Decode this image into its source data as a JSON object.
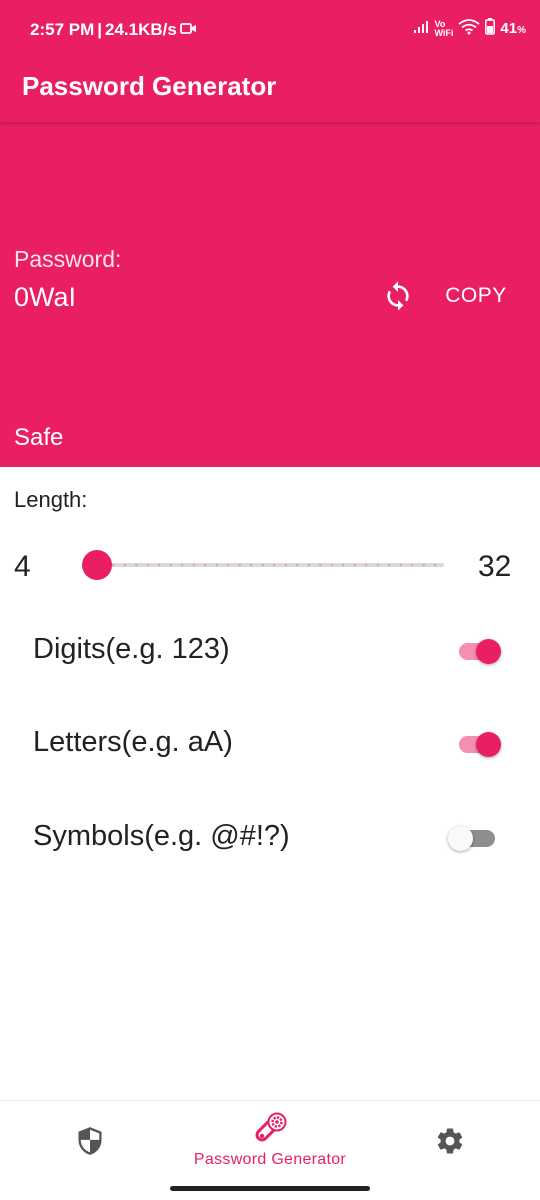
{
  "status_bar": {
    "time": "2:57 PM",
    "separator": "|",
    "speed": "24.1KB/s",
    "vowifi_top": "Vo",
    "vowifi_bottom": "WiFi",
    "battery": "41",
    "battery_unit": "%"
  },
  "app_bar": {
    "title": "Password Generator"
  },
  "password": {
    "label": "Password:",
    "value": "0WaI",
    "copy_label": "COPY",
    "strength": "Safe",
    "refresh_icon": "refresh-icon"
  },
  "length": {
    "label": "Length:",
    "min": "4",
    "max": "32",
    "current_fraction": 0
  },
  "options": [
    {
      "label": "Digits(e.g. 123)",
      "enabled": true
    },
    {
      "label": "Letters(e.g. aA)",
      "enabled": true
    },
    {
      "label": "Symbols(e.g. @#!?)",
      "enabled": false
    }
  ],
  "bottom_nav": {
    "items": [
      {
        "icon": "shield-icon",
        "label": ""
      },
      {
        "icon": "password-generator-icon",
        "label": "Password Generator",
        "active": true
      },
      {
        "icon": "gear-icon",
        "label": ""
      }
    ]
  },
  "colors": {
    "accent": "#E91E63",
    "accent_light": "#F48FB1",
    "text": "#212121"
  }
}
